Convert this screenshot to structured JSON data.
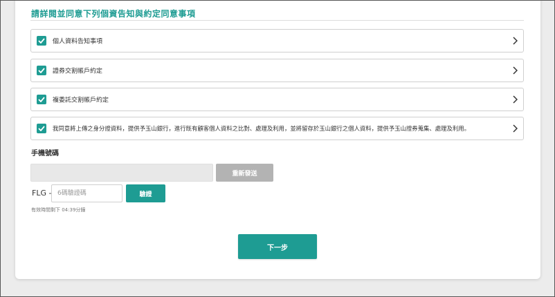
{
  "section": {
    "title": "請詳閱並同意下列個資告知與約定同意事項"
  },
  "agreements": [
    {
      "label": "個人資料告知事項",
      "checked": true
    },
    {
      "label": "證券交割帳戶約定",
      "checked": true
    },
    {
      "label": "複委託交割帳戶約定",
      "checked": true
    },
    {
      "label": "我同意將上傳之身分證資料，提供予玉山銀行，進行既有顧客個人資料之比對、處理及利用，並將留存於玉山銀行之個人資料，提供予玉山證券蒐集、處理及利用。",
      "checked": true
    }
  ],
  "phone": {
    "label": "手機號碼",
    "value": "",
    "resend_label": "重新發送"
  },
  "otp": {
    "prefix": "FLG -",
    "placeholder": "6碼驗證碼",
    "verify_label": "驗證",
    "countdown": "有效時間剩下 04:39分鐘"
  },
  "actions": {
    "next_label": "下一步"
  },
  "colors": {
    "accent": "#1e9c93",
    "disabled": "#b3b3b3",
    "input_disabled_bg": "#e8e8e8"
  }
}
